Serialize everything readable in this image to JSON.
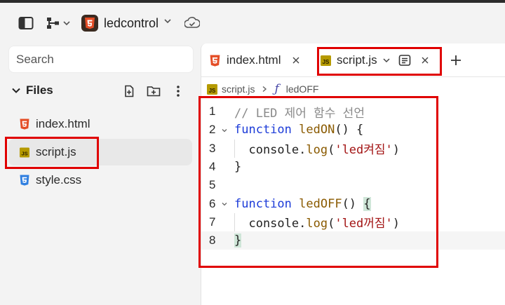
{
  "topbar": {
    "project_name": "ledcontrol"
  },
  "sidebar": {
    "search_placeholder": "Search",
    "files_title": "Files",
    "files": [
      {
        "name": "index.html",
        "type": "html"
      },
      {
        "name": "script.js",
        "type": "js",
        "active": true
      },
      {
        "name": "style.css",
        "type": "css"
      }
    ]
  },
  "tabs": [
    {
      "label": "index.html",
      "type": "html"
    },
    {
      "label": "script.js",
      "type": "js",
      "active": true
    }
  ],
  "breadcrumb": {
    "file": "script.js",
    "symbol": "ledOFF",
    "symbol_icon": "ƒ"
  },
  "code": {
    "line_numbers": [
      "1",
      "2",
      "3",
      "4",
      "5",
      "6",
      "7",
      "8"
    ],
    "lines": [
      {
        "parts": [
          {
            "t": "// LED 제어 함수 선언",
            "c": "cm"
          }
        ]
      },
      {
        "fold": true,
        "parts": [
          {
            "t": "function",
            "c": "kw"
          },
          {
            "t": " ",
            "c": "pl"
          },
          {
            "t": "ledON",
            "c": "fn"
          },
          {
            "t": "() {",
            "c": "pl"
          }
        ]
      },
      {
        "indent": true,
        "parts": [
          {
            "t": "  console.",
            "c": "pl"
          },
          {
            "t": "log",
            "c": "fn"
          },
          {
            "t": "(",
            "c": "pl"
          },
          {
            "t": "'led켜짐'",
            "c": "str"
          },
          {
            "t": ")",
            "c": "pl"
          }
        ]
      },
      {
        "parts": [
          {
            "t": "}",
            "c": "pl"
          }
        ]
      },
      {
        "parts": []
      },
      {
        "fold": true,
        "parts": [
          {
            "t": "function",
            "c": "kw"
          },
          {
            "t": " ",
            "c": "pl"
          },
          {
            "t": "ledOFF",
            "c": "fn"
          },
          {
            "t": "() ",
            "c": "pl"
          },
          {
            "t": "{",
            "c": "pl brace-hl"
          }
        ]
      },
      {
        "indent": true,
        "parts": [
          {
            "t": "  console.",
            "c": "pl"
          },
          {
            "t": "log",
            "c": "fn"
          },
          {
            "t": "(",
            "c": "pl"
          },
          {
            "t": "'led꺼짐'",
            "c": "str"
          },
          {
            "t": ")",
            "c": "pl"
          }
        ]
      },
      {
        "current": true,
        "parts": [
          {
            "t": "}",
            "c": "pl brace-hl"
          }
        ]
      }
    ]
  },
  "colors": {
    "html_icon": "#e44d26",
    "js_icon": "#b59a00",
    "css_icon": "#2f7fe0",
    "annotation": "#e00000"
  },
  "icons": [
    "sidebar-toggle-icon",
    "branch-icon",
    "chevron-down-icon",
    "sync-check-icon",
    "new-file-icon",
    "new-folder-icon",
    "more-icon",
    "close-icon",
    "outline-icon",
    "plus-icon",
    "chevron-right-icon",
    "function-icon"
  ]
}
